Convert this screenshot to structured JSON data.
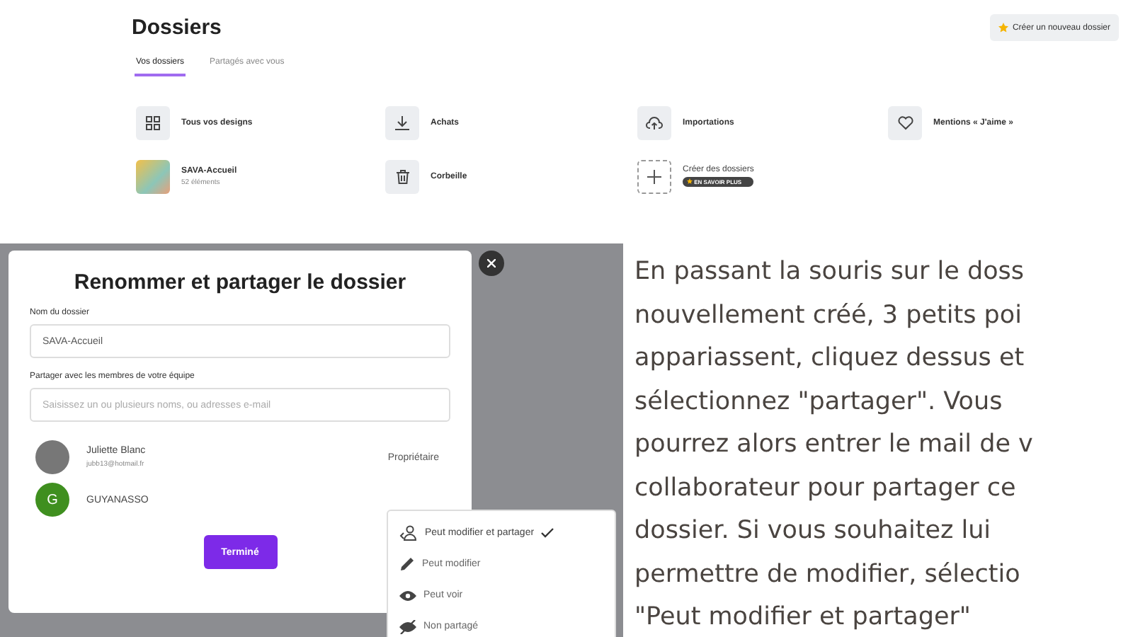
{
  "dossiers_page": {
    "title": "Dossiers",
    "new_folder_button": "Créer un nouveau dossier",
    "tabs": [
      {
        "label": "Vos dossiers",
        "selected": true
      },
      {
        "label": "Partagés avec vous",
        "selected": false
      }
    ],
    "items": [
      {
        "kind": "designs",
        "label": "Tous vos designs"
      },
      {
        "kind": "purchases",
        "label": "Achats"
      },
      {
        "kind": "uploads",
        "label": "Importations"
      },
      {
        "kind": "likes",
        "label": "Mentions « J'aime »"
      },
      {
        "kind": "folder",
        "label": "SAVA-Accueil",
        "count": "52 éléments"
      },
      {
        "kind": "trash",
        "label": "Corbeille"
      },
      {
        "kind": "create",
        "label": "Créer des dossiers",
        "badge": "EN SAVOIR PLUS"
      }
    ]
  },
  "share_dialog": {
    "title": "Renommer et partager le dossier",
    "name_label": "Nom du dossier",
    "name_value": "SAVA-Accueil",
    "share_label": "Partager avec les membres de votre équipe",
    "share_placeholder": "Saisissez un ou plusieurs noms, ou adresses e-mail",
    "members": [
      {
        "kind": "person",
        "name": "Juliette Blanc",
        "email": "jubb13@hotmail.fr",
        "role": "Propriétaire"
      },
      {
        "kind": "team",
        "initial": "G",
        "name": "GUYANASSO"
      }
    ],
    "done_button": "Terminé",
    "permission_menu": [
      {
        "kind": "edit-share",
        "label": "Peut modifier et partager",
        "selected": true
      },
      {
        "kind": "edit",
        "label": "Peut modifier",
        "selected": false
      },
      {
        "kind": "view",
        "label": "Peut voir",
        "selected": false
      },
      {
        "kind": "none",
        "label": "Non partagé",
        "selected": false
      }
    ]
  },
  "instructions": [
    "En passant la souris sur le doss",
    "nouvellement créé, 3 petits poi",
    "appariassent, cliquez dessus et",
    "sélectionnez \"partager\". Vous",
    "pourrez alors entrer le mail de v",
    "collaborateur pour partager ce",
    "dossier. Si vous souhaitez lui",
    "permettre de modifier, sélectio",
    "\"Peut modifier et partager\""
  ]
}
